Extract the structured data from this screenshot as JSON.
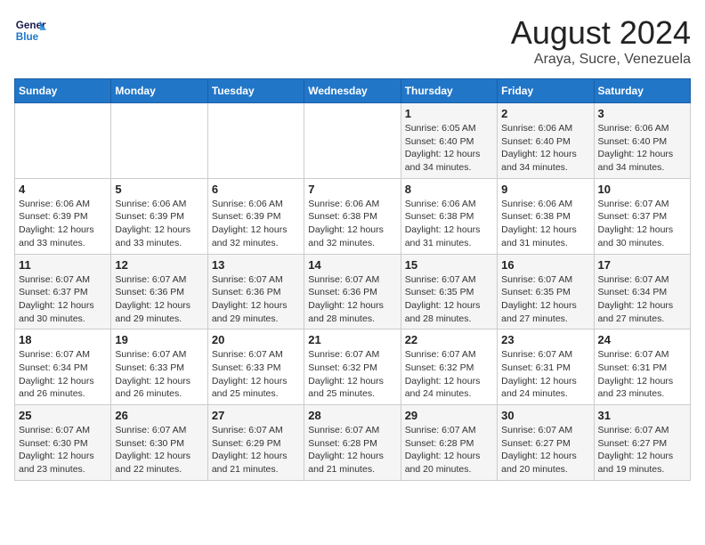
{
  "header": {
    "logo_line1": "General",
    "logo_line2": "Blue",
    "title": "August 2024",
    "subtitle": "Araya, Sucre, Venezuela"
  },
  "weekdays": [
    "Sunday",
    "Monday",
    "Tuesday",
    "Wednesday",
    "Thursday",
    "Friday",
    "Saturday"
  ],
  "weeks": [
    [
      {
        "day": "",
        "detail": ""
      },
      {
        "day": "",
        "detail": ""
      },
      {
        "day": "",
        "detail": ""
      },
      {
        "day": "",
        "detail": ""
      },
      {
        "day": "1",
        "detail": "Sunrise: 6:05 AM\nSunset: 6:40 PM\nDaylight: 12 hours\nand 34 minutes."
      },
      {
        "day": "2",
        "detail": "Sunrise: 6:06 AM\nSunset: 6:40 PM\nDaylight: 12 hours\nand 34 minutes."
      },
      {
        "day": "3",
        "detail": "Sunrise: 6:06 AM\nSunset: 6:40 PM\nDaylight: 12 hours\nand 34 minutes."
      }
    ],
    [
      {
        "day": "4",
        "detail": "Sunrise: 6:06 AM\nSunset: 6:39 PM\nDaylight: 12 hours\nand 33 minutes."
      },
      {
        "day": "5",
        "detail": "Sunrise: 6:06 AM\nSunset: 6:39 PM\nDaylight: 12 hours\nand 33 minutes."
      },
      {
        "day": "6",
        "detail": "Sunrise: 6:06 AM\nSunset: 6:39 PM\nDaylight: 12 hours\nand 32 minutes."
      },
      {
        "day": "7",
        "detail": "Sunrise: 6:06 AM\nSunset: 6:38 PM\nDaylight: 12 hours\nand 32 minutes."
      },
      {
        "day": "8",
        "detail": "Sunrise: 6:06 AM\nSunset: 6:38 PM\nDaylight: 12 hours\nand 31 minutes."
      },
      {
        "day": "9",
        "detail": "Sunrise: 6:06 AM\nSunset: 6:38 PM\nDaylight: 12 hours\nand 31 minutes."
      },
      {
        "day": "10",
        "detail": "Sunrise: 6:07 AM\nSunset: 6:37 PM\nDaylight: 12 hours\nand 30 minutes."
      }
    ],
    [
      {
        "day": "11",
        "detail": "Sunrise: 6:07 AM\nSunset: 6:37 PM\nDaylight: 12 hours\nand 30 minutes."
      },
      {
        "day": "12",
        "detail": "Sunrise: 6:07 AM\nSunset: 6:36 PM\nDaylight: 12 hours\nand 29 minutes."
      },
      {
        "day": "13",
        "detail": "Sunrise: 6:07 AM\nSunset: 6:36 PM\nDaylight: 12 hours\nand 29 minutes."
      },
      {
        "day": "14",
        "detail": "Sunrise: 6:07 AM\nSunset: 6:36 PM\nDaylight: 12 hours\nand 28 minutes."
      },
      {
        "day": "15",
        "detail": "Sunrise: 6:07 AM\nSunset: 6:35 PM\nDaylight: 12 hours\nand 28 minutes."
      },
      {
        "day": "16",
        "detail": "Sunrise: 6:07 AM\nSunset: 6:35 PM\nDaylight: 12 hours\nand 27 minutes."
      },
      {
        "day": "17",
        "detail": "Sunrise: 6:07 AM\nSunset: 6:34 PM\nDaylight: 12 hours\nand 27 minutes."
      }
    ],
    [
      {
        "day": "18",
        "detail": "Sunrise: 6:07 AM\nSunset: 6:34 PM\nDaylight: 12 hours\nand 26 minutes."
      },
      {
        "day": "19",
        "detail": "Sunrise: 6:07 AM\nSunset: 6:33 PM\nDaylight: 12 hours\nand 26 minutes."
      },
      {
        "day": "20",
        "detail": "Sunrise: 6:07 AM\nSunset: 6:33 PM\nDaylight: 12 hours\nand 25 minutes."
      },
      {
        "day": "21",
        "detail": "Sunrise: 6:07 AM\nSunset: 6:32 PM\nDaylight: 12 hours\nand 25 minutes."
      },
      {
        "day": "22",
        "detail": "Sunrise: 6:07 AM\nSunset: 6:32 PM\nDaylight: 12 hours\nand 24 minutes."
      },
      {
        "day": "23",
        "detail": "Sunrise: 6:07 AM\nSunset: 6:31 PM\nDaylight: 12 hours\nand 24 minutes."
      },
      {
        "day": "24",
        "detail": "Sunrise: 6:07 AM\nSunset: 6:31 PM\nDaylight: 12 hours\nand 23 minutes."
      }
    ],
    [
      {
        "day": "25",
        "detail": "Sunrise: 6:07 AM\nSunset: 6:30 PM\nDaylight: 12 hours\nand 23 minutes."
      },
      {
        "day": "26",
        "detail": "Sunrise: 6:07 AM\nSunset: 6:30 PM\nDaylight: 12 hours\nand 22 minutes."
      },
      {
        "day": "27",
        "detail": "Sunrise: 6:07 AM\nSunset: 6:29 PM\nDaylight: 12 hours\nand 21 minutes."
      },
      {
        "day": "28",
        "detail": "Sunrise: 6:07 AM\nSunset: 6:28 PM\nDaylight: 12 hours\nand 21 minutes."
      },
      {
        "day": "29",
        "detail": "Sunrise: 6:07 AM\nSunset: 6:28 PM\nDaylight: 12 hours\nand 20 minutes."
      },
      {
        "day": "30",
        "detail": "Sunrise: 6:07 AM\nSunset: 6:27 PM\nDaylight: 12 hours\nand 20 minutes."
      },
      {
        "day": "31",
        "detail": "Sunrise: 6:07 AM\nSunset: 6:27 PM\nDaylight: 12 hours\nand 19 minutes."
      }
    ]
  ]
}
